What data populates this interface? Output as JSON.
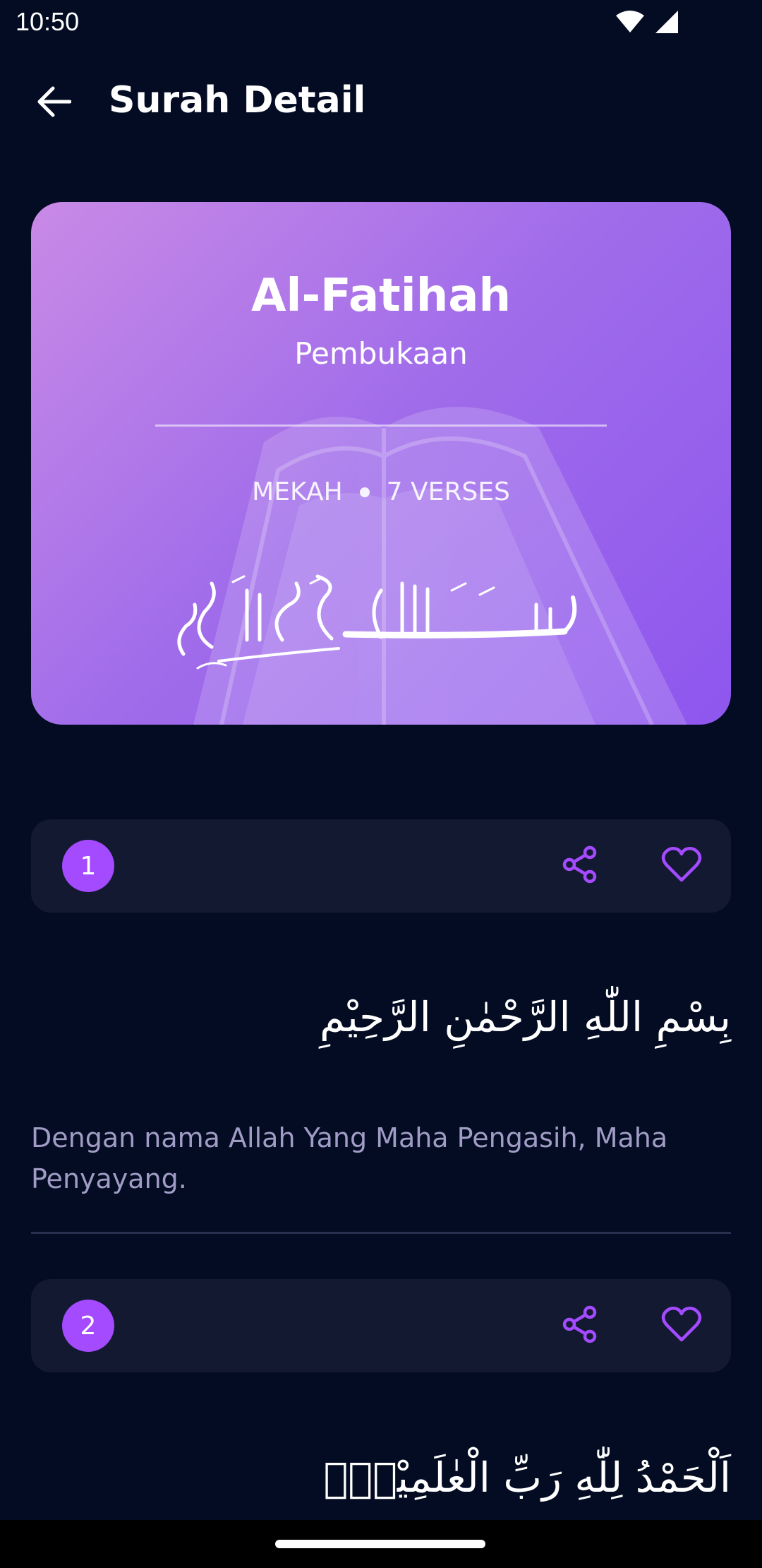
{
  "status_bar": {
    "time": "10:50"
  },
  "app_bar": {
    "title": "Surah Detail"
  },
  "surah": {
    "name": "Al-Fatihah",
    "meaning": "Pembukaan",
    "place": "MEKAH",
    "verses_label": "7 VERSES",
    "basmala_calligraphy": "بِسۡمِ ٱللَّهِ ٱلرَّحۡمَٰنِ ٱلرَّحِيمِ"
  },
  "verses": [
    {
      "number": "1",
      "arabic": "بِسْمِ اللّٰهِ الرَّحْمٰنِ الرَّحِيْمِ",
      "translation": "Dengan nama Allah Yang Maha Pengasih, Maha Penyayang."
    },
    {
      "number": "2",
      "arabic": "اَلْحَمْدُ لِلّٰهِ رَبِّ الْعٰلَمِيْنَۙ"
    }
  ],
  "colors": {
    "background": "#040C23",
    "accent": "#A44AFF",
    "card_start": "#C98AE6",
    "card_end": "#8E56EE",
    "verse_bar": "#121931",
    "translation_text": "#A19CC5"
  },
  "icons": {
    "back": "arrow-left-icon",
    "share": "share-icon",
    "favorite": "heart-outline-icon",
    "wifi": "wifi-icon",
    "signal": "signal-icon"
  }
}
